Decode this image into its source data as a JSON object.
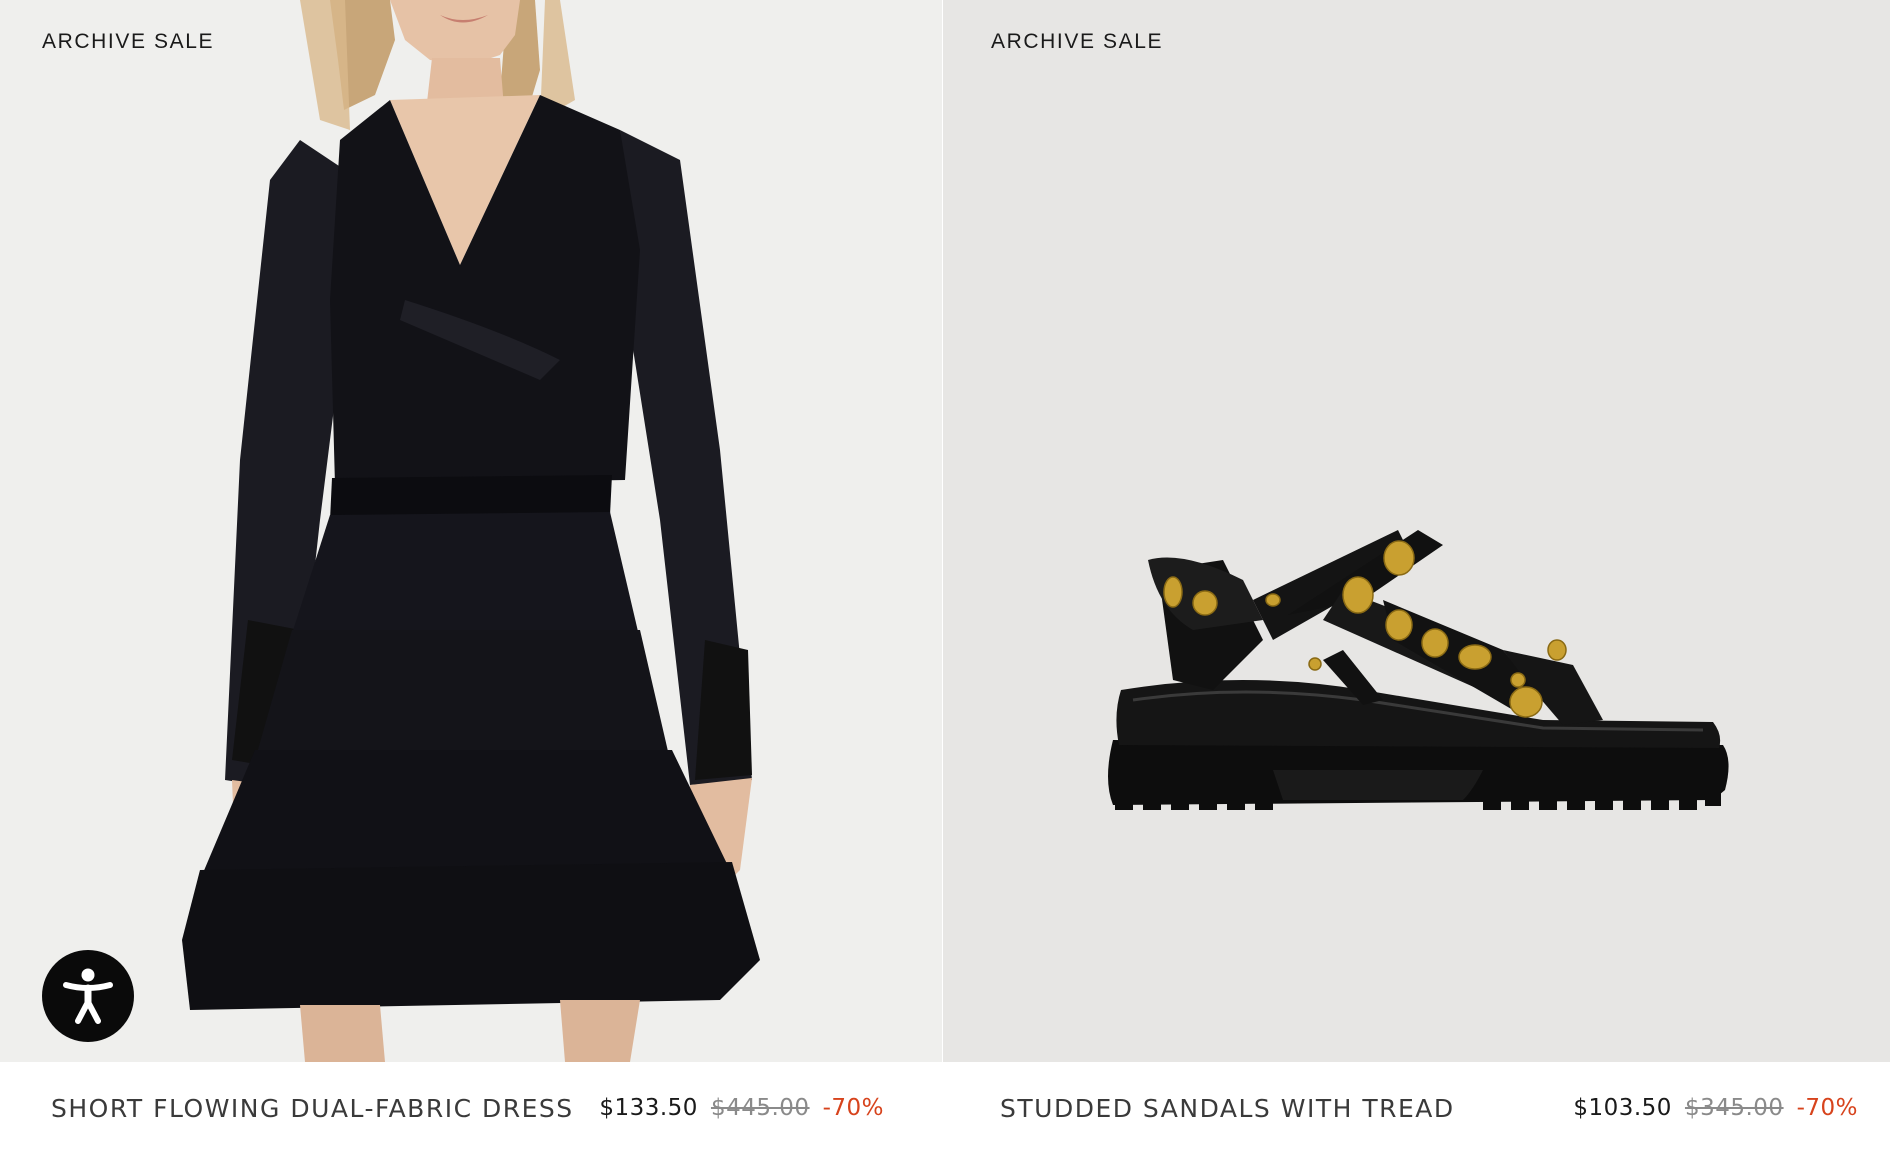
{
  "products": [
    {
      "badge": "ARCHIVE SALE",
      "title": "SHORT FLOWING DUAL-FABRIC DRESS",
      "price": "$133.50",
      "original_price": "$445.00",
      "discount": "-70%",
      "image_icon": "dress-photo"
    },
    {
      "badge": "ARCHIVE SALE",
      "title": "STUDDED SANDALS WITH TREAD",
      "price": "$103.50",
      "original_price": "$345.00",
      "discount": "-70%",
      "image_icon": "sandal-photo"
    }
  ],
  "accessibility": {
    "icon": "accessibility-icon"
  },
  "colors": {
    "discount": "#d7431c",
    "text": "#1a1a1a",
    "strikethrough": "#8a8a8a",
    "image_bg_left": "#efefed",
    "image_bg_right": "#e7e6e4"
  }
}
